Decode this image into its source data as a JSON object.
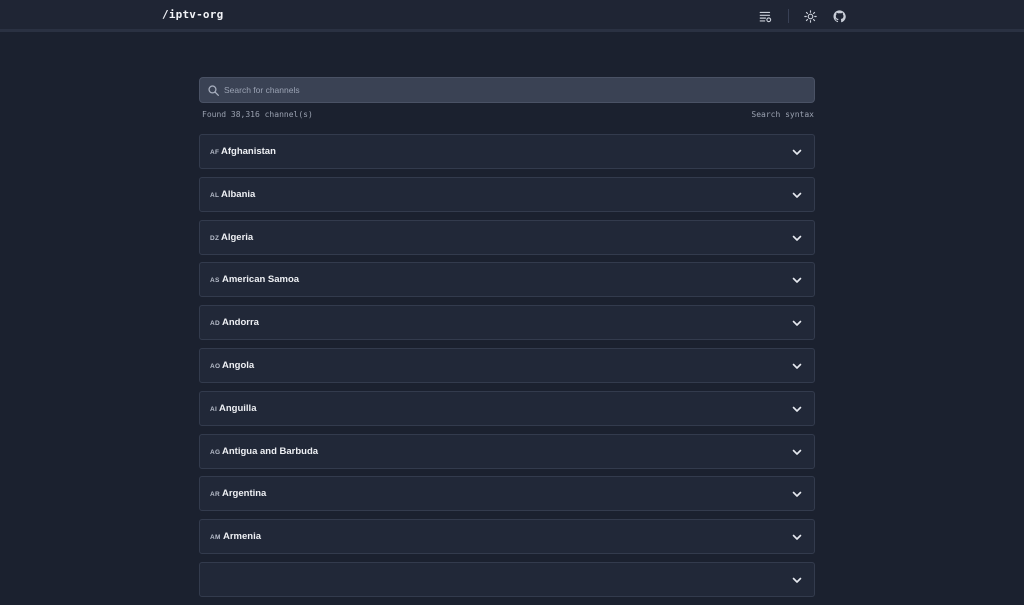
{
  "header": {
    "logo": "/iptv-org",
    "icons": [
      "playlist-settings-icon",
      "sun-icon",
      "github-icon"
    ]
  },
  "search": {
    "placeholder": "Search for channels",
    "value": ""
  },
  "results": {
    "found_text": "Found 38,316 channel(s)",
    "syntax_link": "Search syntax"
  },
  "countries": [
    {
      "code": "AF",
      "name": "Afghanistan"
    },
    {
      "code": "AL",
      "name": "Albania"
    },
    {
      "code": "DZ",
      "name": "Algeria"
    },
    {
      "code": "AS",
      "name": "American Samoa"
    },
    {
      "code": "AD",
      "name": "Andorra"
    },
    {
      "code": "AO",
      "name": "Angola"
    },
    {
      "code": "AI",
      "name": "Anguilla"
    },
    {
      "code": "AG",
      "name": "Antigua and Barbuda"
    },
    {
      "code": "AR",
      "name": "Argentina"
    },
    {
      "code": "AM",
      "name": "Armenia"
    },
    {
      "code": "",
      "name": ""
    }
  ],
  "colors": {
    "background": "#1b212f",
    "card": "#212838",
    "card_border": "#333b4d",
    "search_bg": "#3a4254",
    "text": "#e6e9ef",
    "muted": "#9aa1b0"
  }
}
